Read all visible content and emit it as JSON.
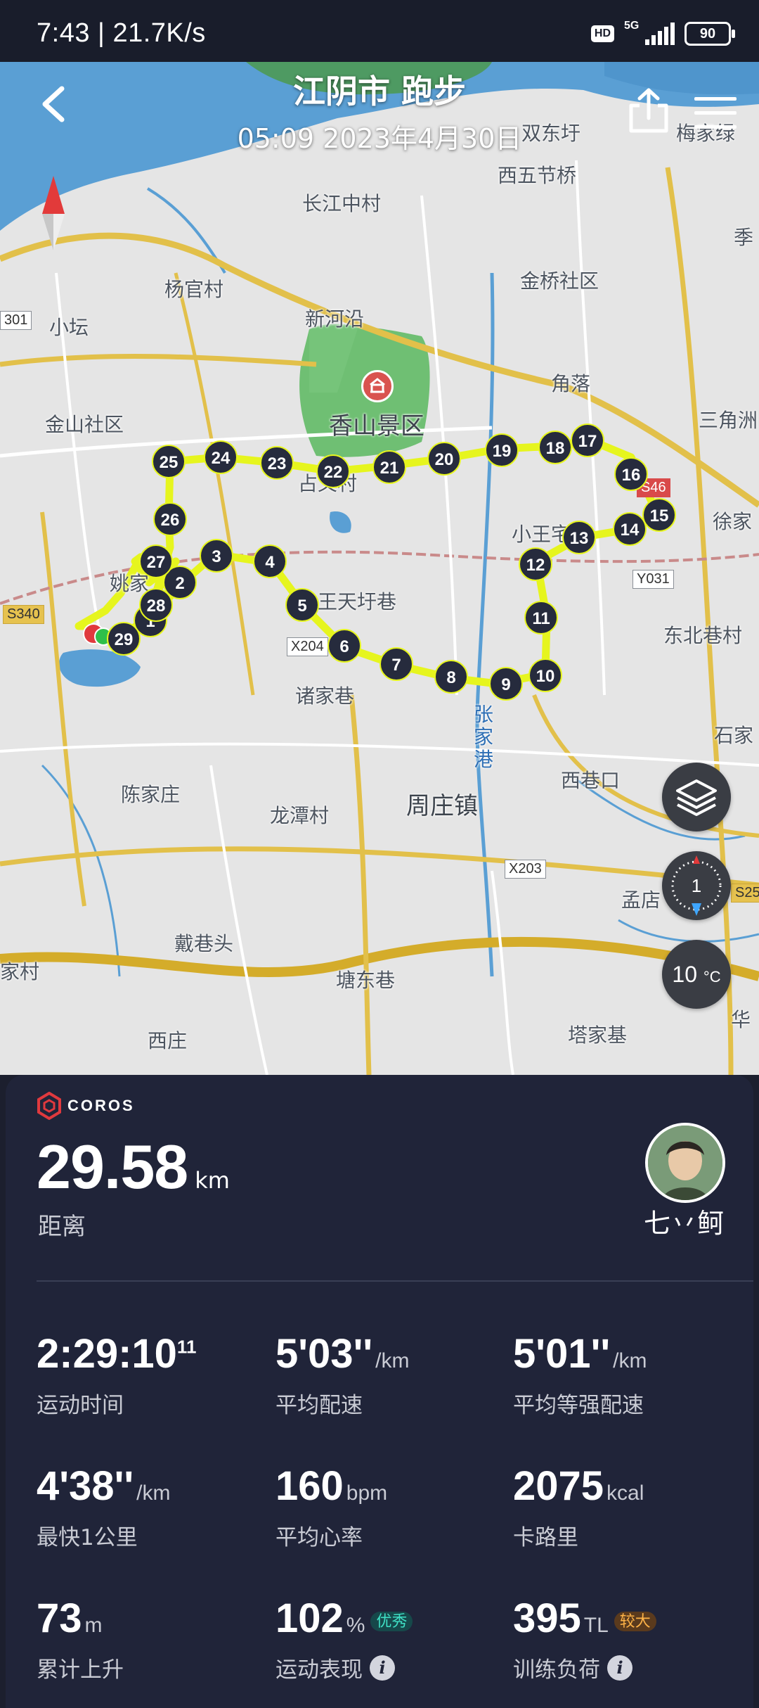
{
  "status_bar": {
    "time_speed": "7:43 | 21.7K/s",
    "hd_label": "HD",
    "network": "5G",
    "battery": "90"
  },
  "header": {
    "title": "江阴市 跑步",
    "subtitle": "05:09 2023年4月30日"
  },
  "map": {
    "labels": {
      "shuangdong": "双东圩",
      "meijia": "梅家绿",
      "xiwujie": "西五节桥",
      "changjiang": "长江中村",
      "ji": "季",
      "yangguan": "杨官村",
      "jinqiao": "金桥社区",
      "xinhe": "新河沿",
      "xiaotan": "小坛",
      "jiaoluo": "角落",
      "sanjiao": "三角洲",
      "jinshan": "金山社区",
      "xiangshan": "香山景区",
      "zhanyi": "占义村",
      "xiaowang": "小王宅",
      "xujia": "徐家",
      "yaojia": "姚家",
      "wangtian": "王天圩巷",
      "dongbei": "东北巷村",
      "zhujia": "诸家巷",
      "zhangjiagang": "张家港",
      "shijia": "石家",
      "xixiangkou": "西巷口",
      "chenjia": "陈家庄",
      "longtan": "龙潭村",
      "zhouzhuang": "周庄镇",
      "mengdian": "孟店",
      "daixiang": "戴巷头",
      "jiacun": "家村",
      "tangdong": "塘东巷",
      "xizhuang": "西庄",
      "tajiaji": "塔家基",
      "hua": "华"
    },
    "road_tags": {
      "s301": "301",
      "s340": "S340",
      "x204": "X204",
      "y031": "Y031",
      "x203": "X203",
      "s25": "S25",
      "s46": "S46"
    },
    "markers": [
      "1",
      "2",
      "3",
      "4",
      "5",
      "6",
      "7",
      "8",
      "9",
      "10",
      "11",
      "12",
      "13",
      "14",
      "15",
      "16",
      "17",
      "18",
      "19",
      "20",
      "21",
      "22",
      "23",
      "24",
      "25",
      "26",
      "27",
      "28",
      "29"
    ],
    "compass_value": "1",
    "temperature": "10",
    "temperature_unit": "°C",
    "route_color": "#e6f51e",
    "marker_color": "#262b3d"
  },
  "summary": {
    "brand": "COROS",
    "distance_value": "29.58",
    "distance_unit": "km",
    "distance_label": "距离",
    "username": "七丷鲄"
  },
  "stats": [
    {
      "value": "2:29:10",
      "sup": "11",
      "unit": "",
      "label": "运动时间"
    },
    {
      "value": "5'03''",
      "unit": "/km",
      "label": "平均配速"
    },
    {
      "value": "5'01''",
      "unit": "/km",
      "label": "平均等强配速"
    },
    {
      "value": "4'38''",
      "unit": "/km",
      "label": "最快1公里"
    },
    {
      "value": "160",
      "unit": "bpm",
      "label": "平均心率"
    },
    {
      "value": "2075",
      "unit": "kcal",
      "label": "卡路里"
    },
    {
      "value": "73",
      "unit": "m",
      "label": "累计上升"
    },
    {
      "value": "102",
      "unit": "%",
      "badge": "优秀",
      "label": "运动表现"
    },
    {
      "value": "395",
      "unit": "TL",
      "badge": "较大",
      "label": "训练负荷"
    }
  ],
  "colors": {
    "panel_bg": "#202439",
    "water": "#5a9fd4",
    "park": "#6fbf73",
    "road_major": "#e2c04a",
    "brand_red": "#e0393e"
  }
}
